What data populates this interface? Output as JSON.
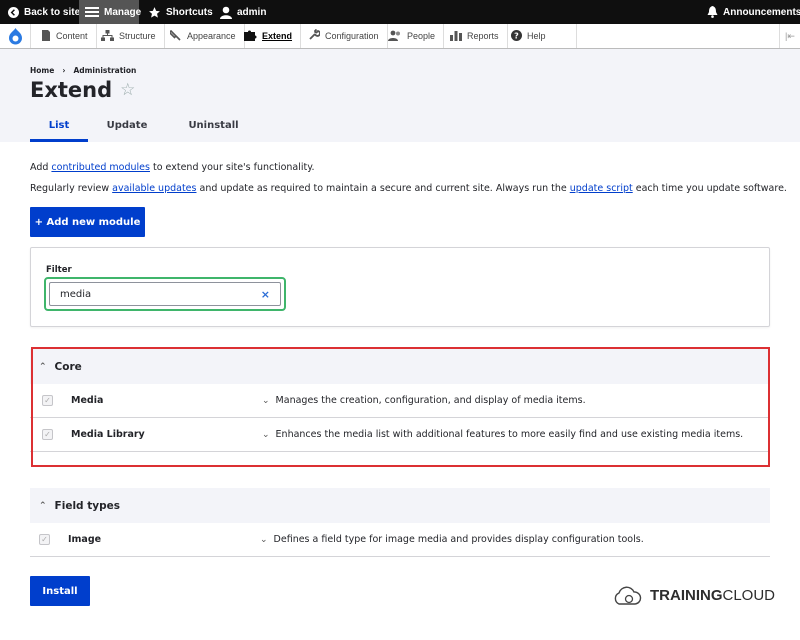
{
  "toolbar": {
    "back_label": "Back to site",
    "manage_label": "Manage",
    "shortcuts_label": "Shortcuts",
    "user_label": "admin",
    "announcements_label": "Announcements"
  },
  "tray": {
    "items": [
      {
        "label": "Content",
        "icon": "content-icon"
      },
      {
        "label": "Structure",
        "icon": "structure-icon"
      },
      {
        "label": "Appearance",
        "icon": "appearance-icon"
      },
      {
        "label": "Extend",
        "icon": "extend-icon"
      },
      {
        "label": "Configuration",
        "icon": "wrench-icon"
      },
      {
        "label": "People",
        "icon": "people-icon"
      },
      {
        "label": "Reports",
        "icon": "reports-icon"
      },
      {
        "label": "Help",
        "icon": "help-icon"
      }
    ],
    "active": "Extend"
  },
  "header": {
    "breadcrumb": [
      "Home",
      "›",
      "Administration"
    ],
    "title": "Extend",
    "tabs": [
      "List",
      "Update",
      "Uninstall"
    ],
    "active_tab": "List"
  },
  "intro": {
    "p1_before": "Add ",
    "p1_link": "contributed modules",
    "p1_after": " to extend your site's functionality.",
    "p2_before": "Regularly review ",
    "p2_link1": "available updates",
    "p2_mid": " and update as required to maintain a secure and current site. Always run the ",
    "p2_link2": "update script",
    "p2_after": " each time you update software."
  },
  "add_button_label": "+ Add new module",
  "filter": {
    "label": "Filter",
    "value": "media",
    "clear_symbol": "×"
  },
  "sections": [
    {
      "title": "Core",
      "rows": [
        {
          "name": "Media",
          "description": "Manages the creation, configuration, and display of media items."
        },
        {
          "name": "Media Library",
          "description": "Enhances the media list with additional features to more easily find and use existing media items."
        }
      ]
    },
    {
      "title": "Field types",
      "rows": [
        {
          "name": "Image",
          "description": "Defines a field type for image media and provides display configuration tools."
        }
      ]
    }
  ],
  "install_label": "Install",
  "brand": {
    "bold": "TRAINING",
    "rest": "CLOUD"
  },
  "colors": {
    "accent": "#003ecc",
    "highlight_green": "#3fb56b",
    "highlight_red": "#dc3033",
    "toolbar": "#0f0f0f"
  }
}
